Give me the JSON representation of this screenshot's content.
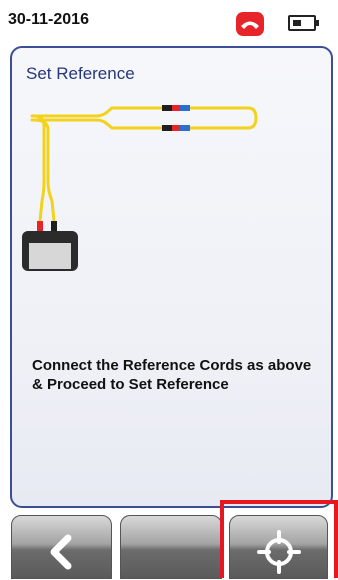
{
  "status_bar": {
    "date": "30-11-2016",
    "phone_icon": "phone-hangup-icon",
    "battery_icon": "battery-icon",
    "accent_color": "#e8242b"
  },
  "panel": {
    "title": "Set Reference",
    "instructions": "Connect the Reference Cords as above & Proceed to Set Reference",
    "border_color": "#3a4f95"
  },
  "toolbar": {
    "buttons": [
      {
        "icon": "back-arrow-icon"
      },
      {
        "icon": ""
      },
      {
        "icon": "crosshair-icon",
        "highlighted": true
      }
    ],
    "highlight_color": "#e5171f"
  }
}
